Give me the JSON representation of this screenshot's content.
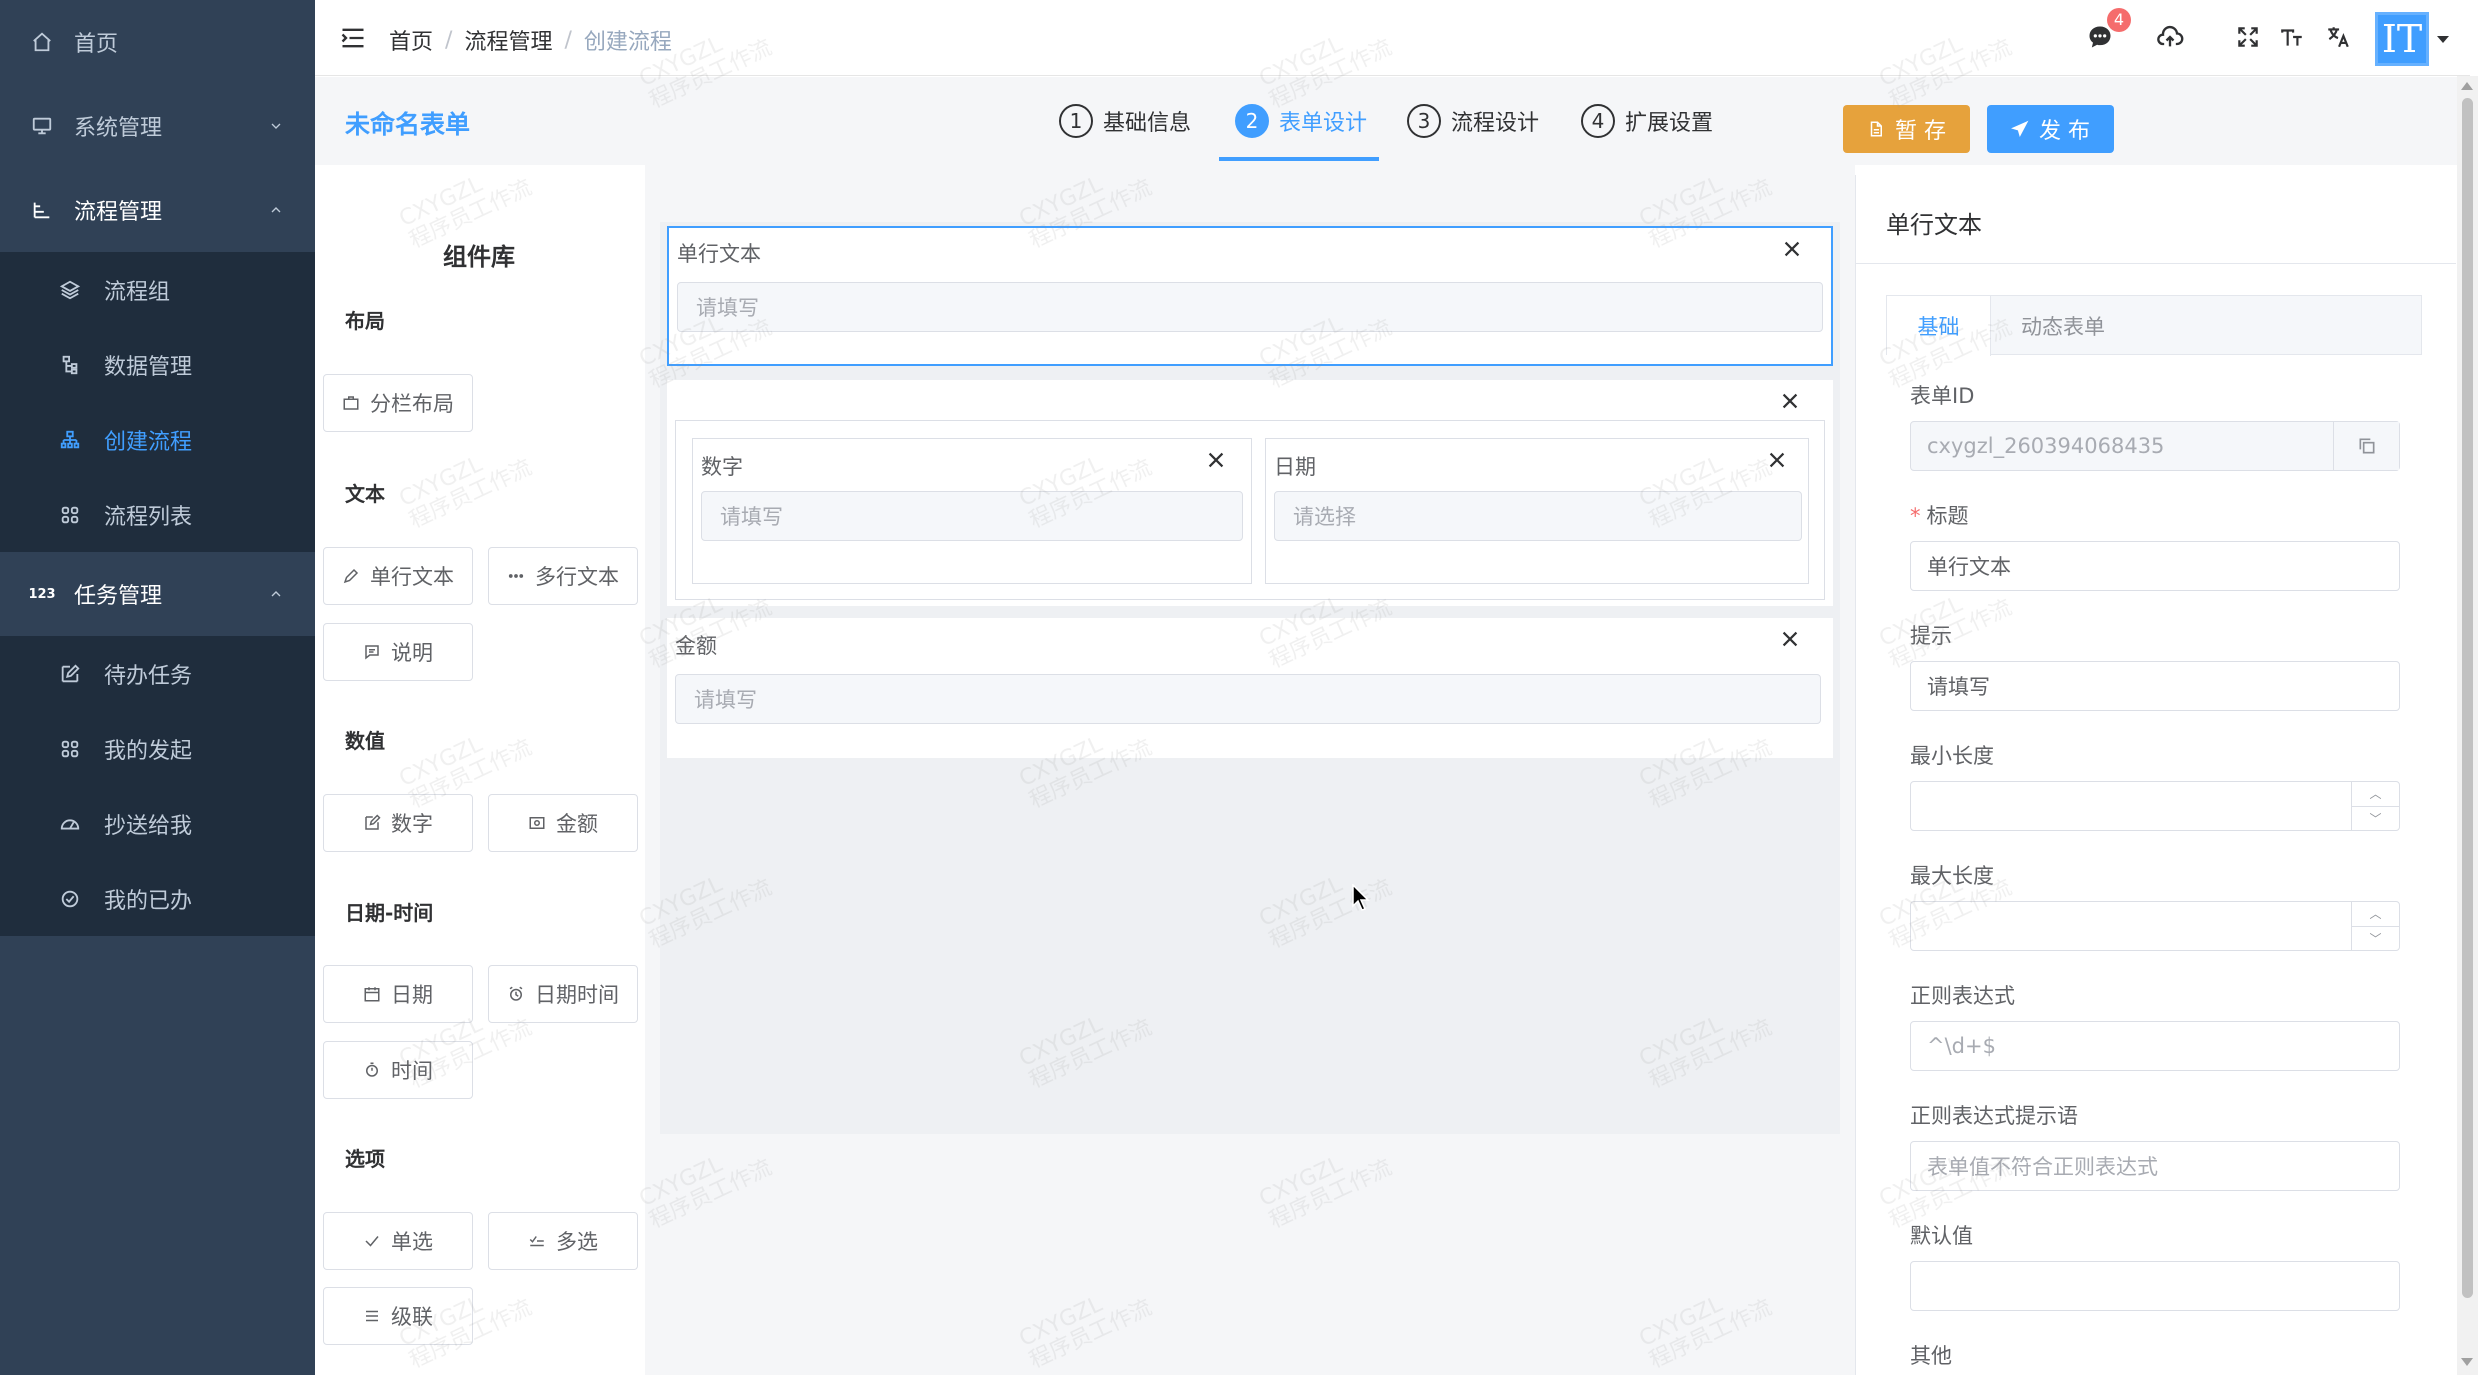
{
  "sidebar": {
    "home": "首页",
    "system": "系统管理",
    "flow": "流程管理",
    "flow_items": [
      "流程组",
      "数据管理",
      "创建流程",
      "流程列表"
    ],
    "task": "任务管理",
    "task_items": [
      "待办任务",
      "我的发起",
      "抄送给我",
      "我的已办"
    ]
  },
  "navbar": {
    "breadcrumb": [
      "首页",
      "流程管理",
      "创建流程"
    ],
    "notify_count": "4",
    "avatar_text": "IT"
  },
  "designer": {
    "form_title": "未命名表单",
    "steps": [
      {
        "num": "1",
        "label": "基础信息"
      },
      {
        "num": "2",
        "label": "表单设计"
      },
      {
        "num": "3",
        "label": "流程设计"
      },
      {
        "num": "4",
        "label": "扩展设置"
      }
    ],
    "save_label": "暂 存",
    "publish_label": "发 布"
  },
  "library": {
    "title": "组件库",
    "groups": {
      "layout": "布局",
      "text": "文本",
      "number": "数值",
      "datetime": "日期-时间",
      "options": "选项"
    },
    "buttons": {
      "columns": "分栏布局",
      "single_text": "单行文本",
      "multi_text": "多行文本",
      "description": "说明",
      "number": "数字",
      "amount": "金额",
      "date": "日期",
      "datetime": "日期时间",
      "time": "时间",
      "radio": "单选",
      "checkbox": "多选",
      "cascade": "级联"
    }
  },
  "canvas": {
    "field1": {
      "label": "单行文本",
      "placeholder": "请填写"
    },
    "field_number": {
      "label": "数字",
      "placeholder": "请填写"
    },
    "field_date": {
      "label": "日期",
      "placeholder": "请选择"
    },
    "field_amount": {
      "label": "金额",
      "placeholder": "请填写"
    }
  },
  "props": {
    "title": "单行文本",
    "tabs": [
      "基础",
      "动态表单"
    ],
    "form_id_label": "表单ID",
    "form_id_value": "cxygzl_260394068435",
    "title_label": "标题",
    "title_value": "单行文本",
    "hint_label": "提示",
    "hint_value": "请填写",
    "min_len_label": "最小长度",
    "max_len_label": "最大长度",
    "regex_label": "正则表达式",
    "regex_placeholder": "^\\d+$",
    "regex_msg_label": "正则表达式提示语",
    "regex_msg_placeholder": "表单值不符合正则表达式",
    "default_label": "默认值",
    "other_label": "其他"
  },
  "watermark": {
    "line1": "CXYGZL",
    "line2": "程序员工作流"
  },
  "colors": {
    "primary": "#409eff",
    "warning": "#e6a23c",
    "sidebar": "#304156",
    "submenu": "#1f2d3d",
    "danger": "#f56c6c"
  }
}
